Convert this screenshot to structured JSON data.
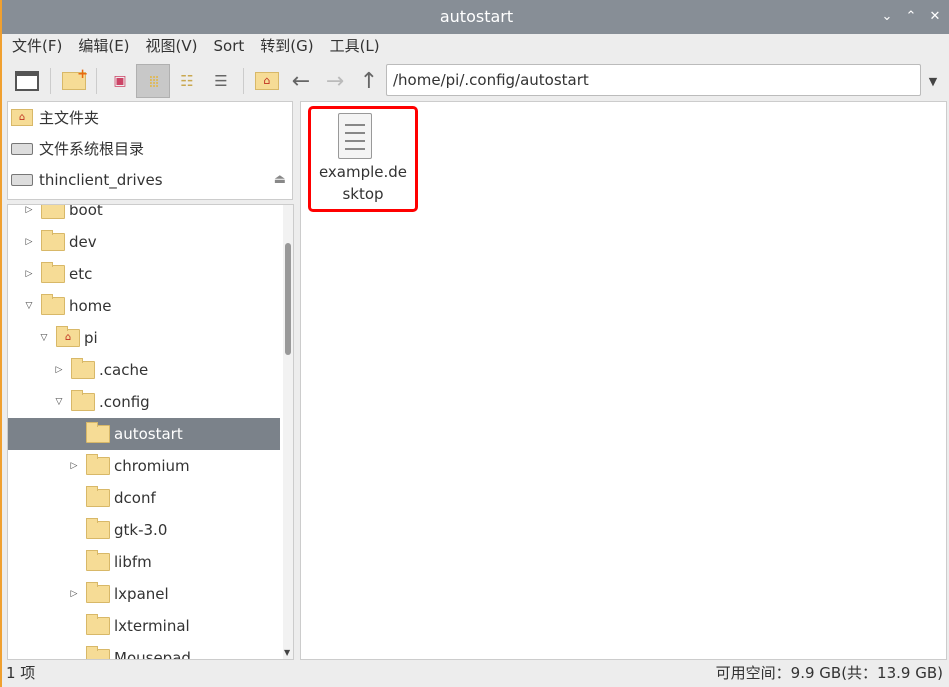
{
  "window": {
    "title": "autostart"
  },
  "menu": [
    "文件(F)",
    "编辑(E)",
    "视图(V)",
    "Sort",
    "转到(G)",
    "工具(L)"
  ],
  "address": {
    "path": "/home/pi/.config/autostart"
  },
  "places": [
    {
      "label": "主文件夹",
      "icon": "home-icon"
    },
    {
      "label": "文件系统根目录",
      "icon": "drive-icon"
    },
    {
      "label": "thinclient_drives",
      "icon": "drive-icon"
    }
  ],
  "tree": [
    {
      "label": "boot",
      "level": 0,
      "arrow": "right"
    },
    {
      "label": "dev",
      "level": 0,
      "arrow": "right"
    },
    {
      "label": "etc",
      "level": 0,
      "arrow": "right"
    },
    {
      "label": "home",
      "level": 0,
      "arrow": "down"
    },
    {
      "label": "pi",
      "level": 1,
      "arrow": "down",
      "home": true
    },
    {
      "label": ".cache",
      "level": 2,
      "arrow": "right"
    },
    {
      "label": ".config",
      "level": 2,
      "arrow": "down"
    },
    {
      "label": "autostart",
      "level": 3,
      "arrow": "",
      "selected": true
    },
    {
      "label": "chromium",
      "level": 3,
      "arrow": "right"
    },
    {
      "label": "dconf",
      "level": 3,
      "arrow": ""
    },
    {
      "label": "gtk-3.0",
      "level": 3,
      "arrow": ""
    },
    {
      "label": "libfm",
      "level": 3,
      "arrow": ""
    },
    {
      "label": "lxpanel",
      "level": 3,
      "arrow": "right"
    },
    {
      "label": "lxterminal",
      "level": 3,
      "arrow": ""
    },
    {
      "label": "Mousepad",
      "level": 3,
      "arrow": ""
    }
  ],
  "files": [
    {
      "name_line1": "example.de",
      "name_line2": "sktop"
    }
  ],
  "status": {
    "count": "1 项",
    "space": "可用空间：9.9 GB(共：13.9 GB)"
  }
}
